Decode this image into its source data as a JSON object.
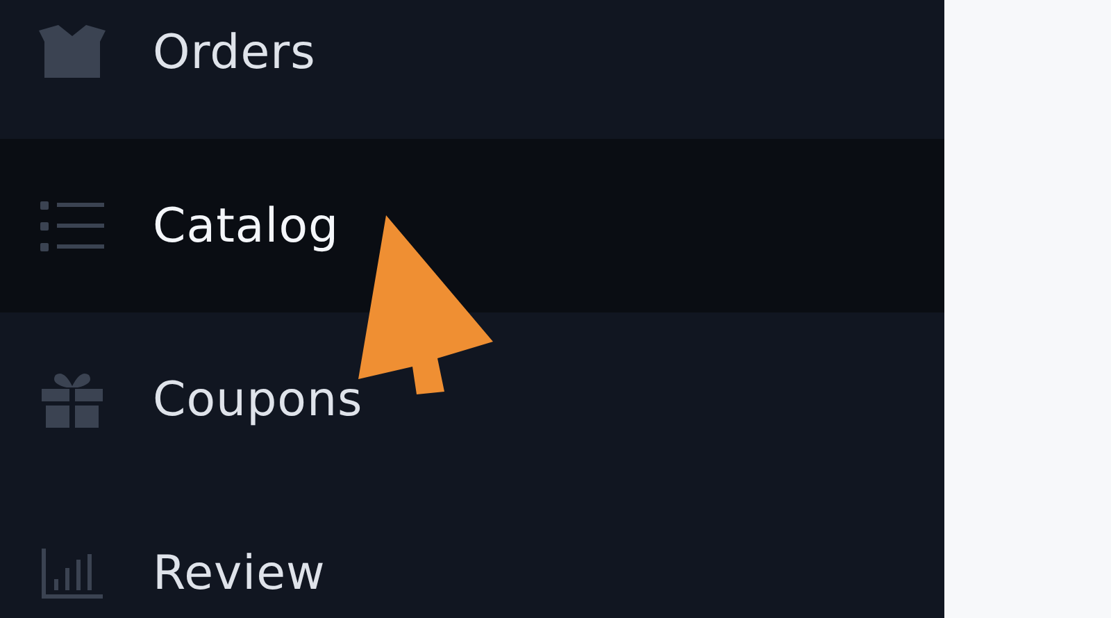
{
  "sidebar": {
    "items": [
      {
        "label": "Orders",
        "selected": false
      },
      {
        "label": "Catalog",
        "selected": true
      },
      {
        "label": "Coupons",
        "selected": false
      },
      {
        "label": "Review",
        "selected": false
      }
    ]
  }
}
